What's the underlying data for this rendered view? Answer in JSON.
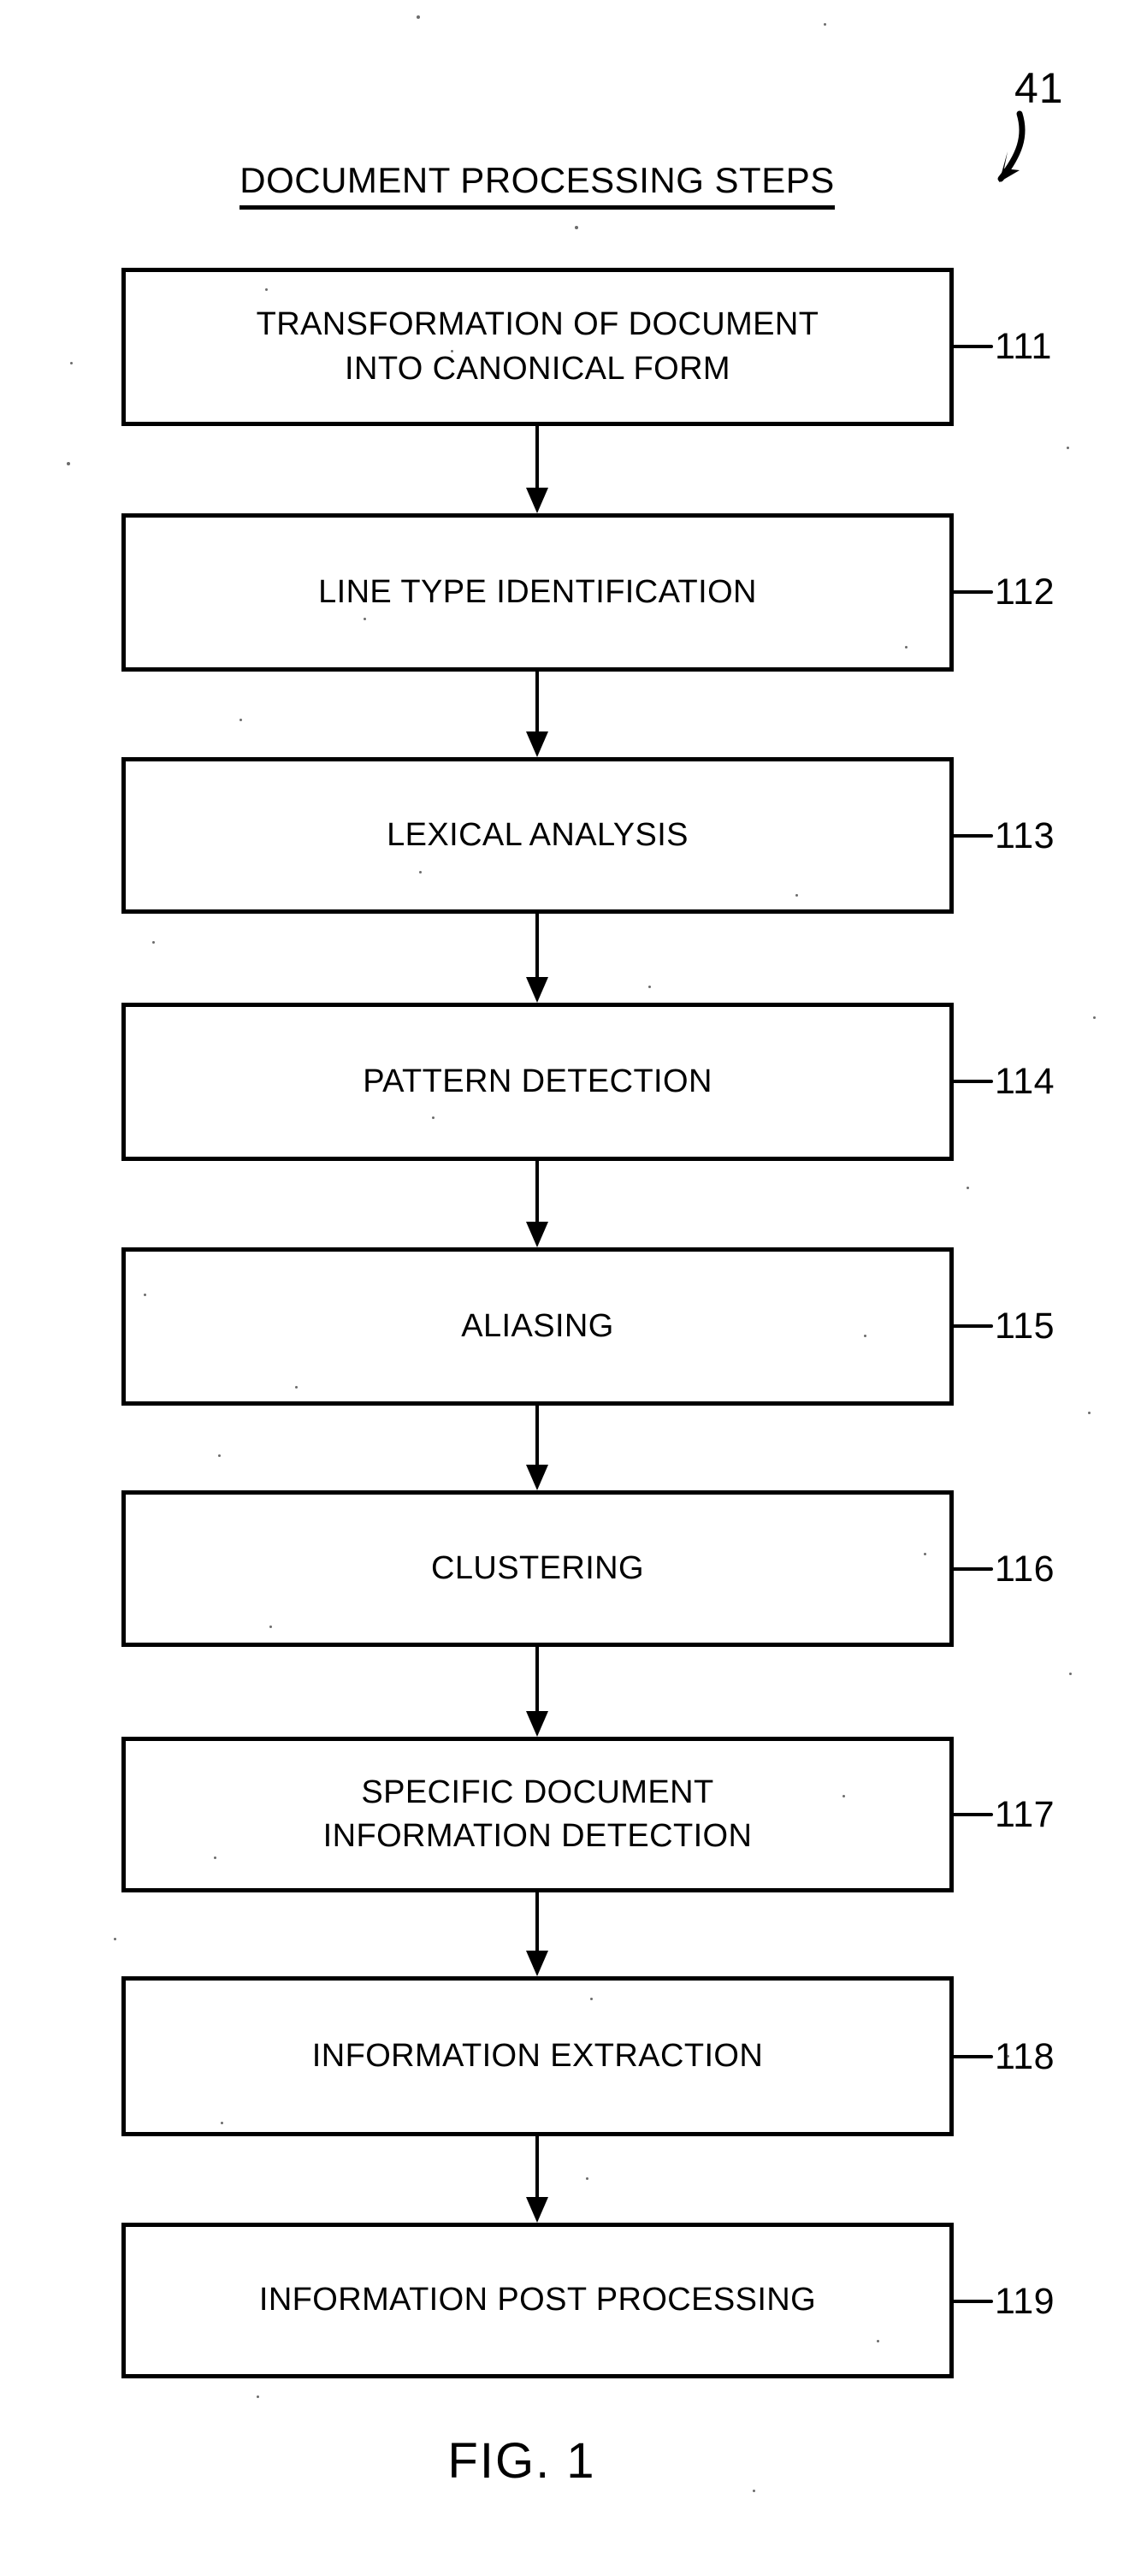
{
  "figure": {
    "reference_numeral": "41",
    "title": "DOCUMENT PROCESSING STEPS",
    "caption": "FIG. 1",
    "ink_color": "#000000",
    "background_color": "#ffffff"
  },
  "steps": [
    {
      "label": "TRANSFORMATION OF DOCUMENT\nINTO CANONICAL FORM",
      "ref": "111"
    },
    {
      "label": "LINE TYPE IDENTIFICATION",
      "ref": "112"
    },
    {
      "label": "LEXICAL ANALYSIS",
      "ref": "113"
    },
    {
      "label": "PATTERN DETECTION",
      "ref": "114"
    },
    {
      "label": "ALIASING",
      "ref": "115"
    },
    {
      "label": "CLUSTERING",
      "ref": "116"
    },
    {
      "label": "SPECIFIC DOCUMENT\nINFORMATION DETECTION",
      "ref": "117"
    },
    {
      "label": "INFORMATION EXTRACTION",
      "ref": "118"
    },
    {
      "label": "INFORMATION POST PROCESSING",
      "ref": "119"
    }
  ]
}
